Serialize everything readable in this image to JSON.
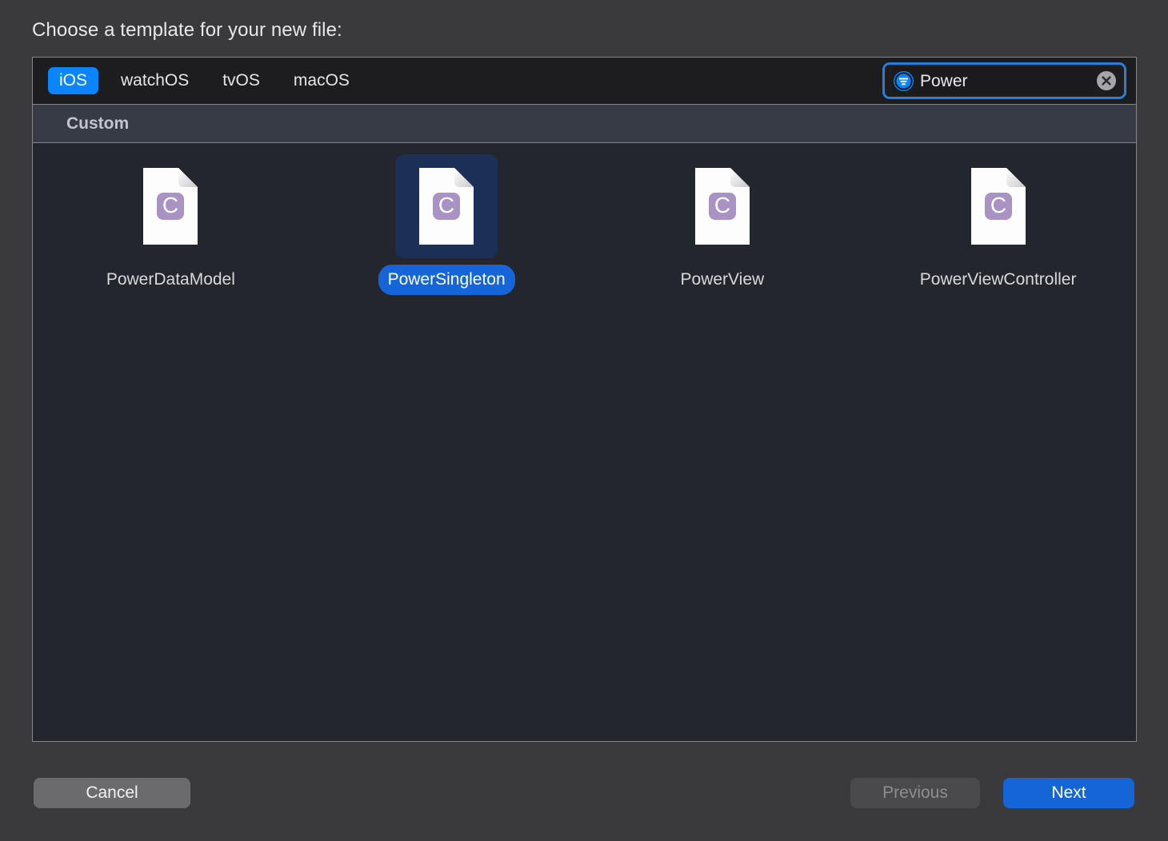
{
  "dialog": {
    "title": "Choose a template for your new file:"
  },
  "platform_tabs": [
    {
      "label": "iOS",
      "selected": true
    },
    {
      "label": "watchOS",
      "selected": false
    },
    {
      "label": "tvOS",
      "selected": false
    },
    {
      "label": "macOS",
      "selected": false
    }
  ],
  "search": {
    "value": "Power",
    "placeholder": "Filter",
    "filter_icon": "filter-icon",
    "clear_icon": "clear-icon",
    "focused": true,
    "accent_color": "#2a7fd4"
  },
  "section": {
    "title": "Custom"
  },
  "templates": [
    {
      "label": "PowerDataModel",
      "icon": "c-source-file-icon",
      "selected": false
    },
    {
      "label": "PowerSingleton",
      "icon": "c-source-file-icon",
      "selected": true
    },
    {
      "label": "PowerView",
      "icon": "c-source-file-icon",
      "selected": false
    },
    {
      "label": "PowerViewController",
      "icon": "c-source-file-icon",
      "selected": false
    }
  ],
  "footer": {
    "cancel_label": "Cancel",
    "previous_label": "Previous",
    "previous_disabled": true,
    "next_label": "Next"
  },
  "colors": {
    "selection_blue": "#0a84ff",
    "label_pill_blue": "#1565d8",
    "icon_badge_purple": "#a893c4",
    "panel_background": "#24262d",
    "section_header": "#363b45"
  }
}
